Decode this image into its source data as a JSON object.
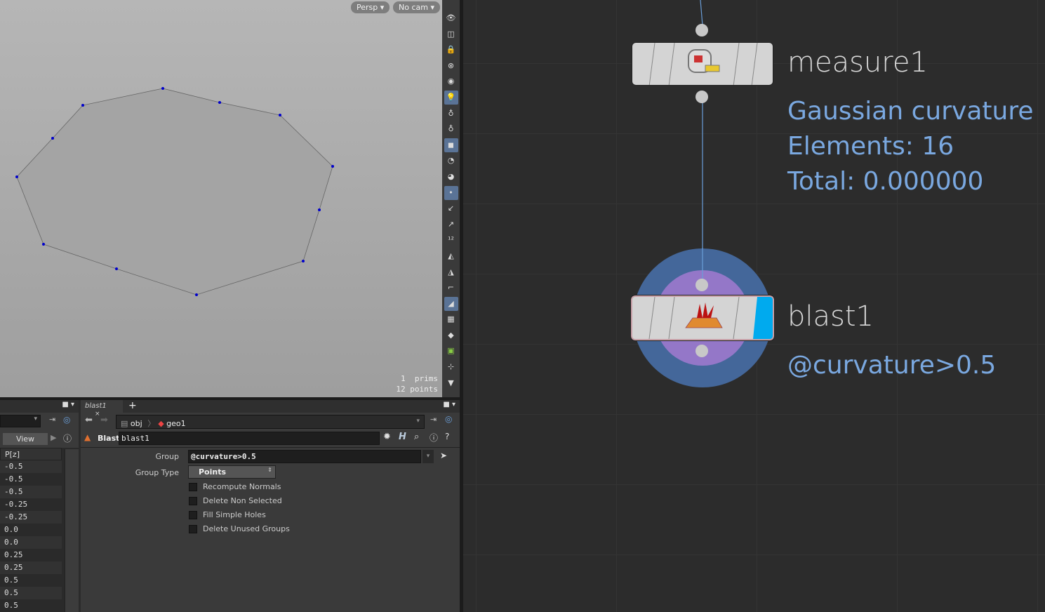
{
  "viewport": {
    "camera_menu": "Persp ▾",
    "cam_menu": "No cam ▾",
    "stats": {
      "prims_count": "1",
      "prims_label": "prims",
      "points_count": "12",
      "points_label": "points"
    },
    "point_color": "#0000cc"
  },
  "viewport_toolbar": [
    "visibility",
    "display-options",
    "lock",
    "ghost",
    "shading",
    "light-headlight",
    "light-normal",
    "light-high-quality",
    "shadows",
    "background",
    "reference",
    "point-display",
    "normals",
    "point-normals",
    "point-numbers",
    "prim-normals",
    "prim-numbers",
    "hull",
    "uv",
    "texture",
    "vertex",
    "bbox",
    "handle",
    "more"
  ],
  "spreadsheet": {
    "view_label": "View",
    "column_header": "P[z]",
    "values": [
      "-0.5",
      "-0.5",
      "-0.5",
      "-0.25",
      "-0.25",
      "0.0",
      "0.0",
      "0.25",
      "0.25",
      "0.5",
      "0.5",
      "0.5"
    ]
  },
  "parameters": {
    "tab_label": "blast1",
    "tab_close": "×",
    "add_tab": "+",
    "path": {
      "root": "obj",
      "node": "geo1"
    },
    "node_type": "Blast",
    "node_name": "blast1",
    "group_label": "Group",
    "group_value": "@curvature>0.5",
    "group_type_label": "Group Type",
    "group_type_value": "Points",
    "checkboxes": [
      "Recompute Normals",
      "Delete Non Selected",
      "Fill Simple Holes",
      "Delete Unused Groups"
    ]
  },
  "network": {
    "nodes": [
      {
        "name": "measure1",
        "info": [
          "Gaussian curvature",
          "Elements: 16",
          "Total: 0.000000"
        ]
      },
      {
        "name": "blast1",
        "info": [
          "@curvature>0.5"
        ],
        "display_flag_color": "#00aaee"
      }
    ],
    "info_color": "#7aa8e0"
  }
}
